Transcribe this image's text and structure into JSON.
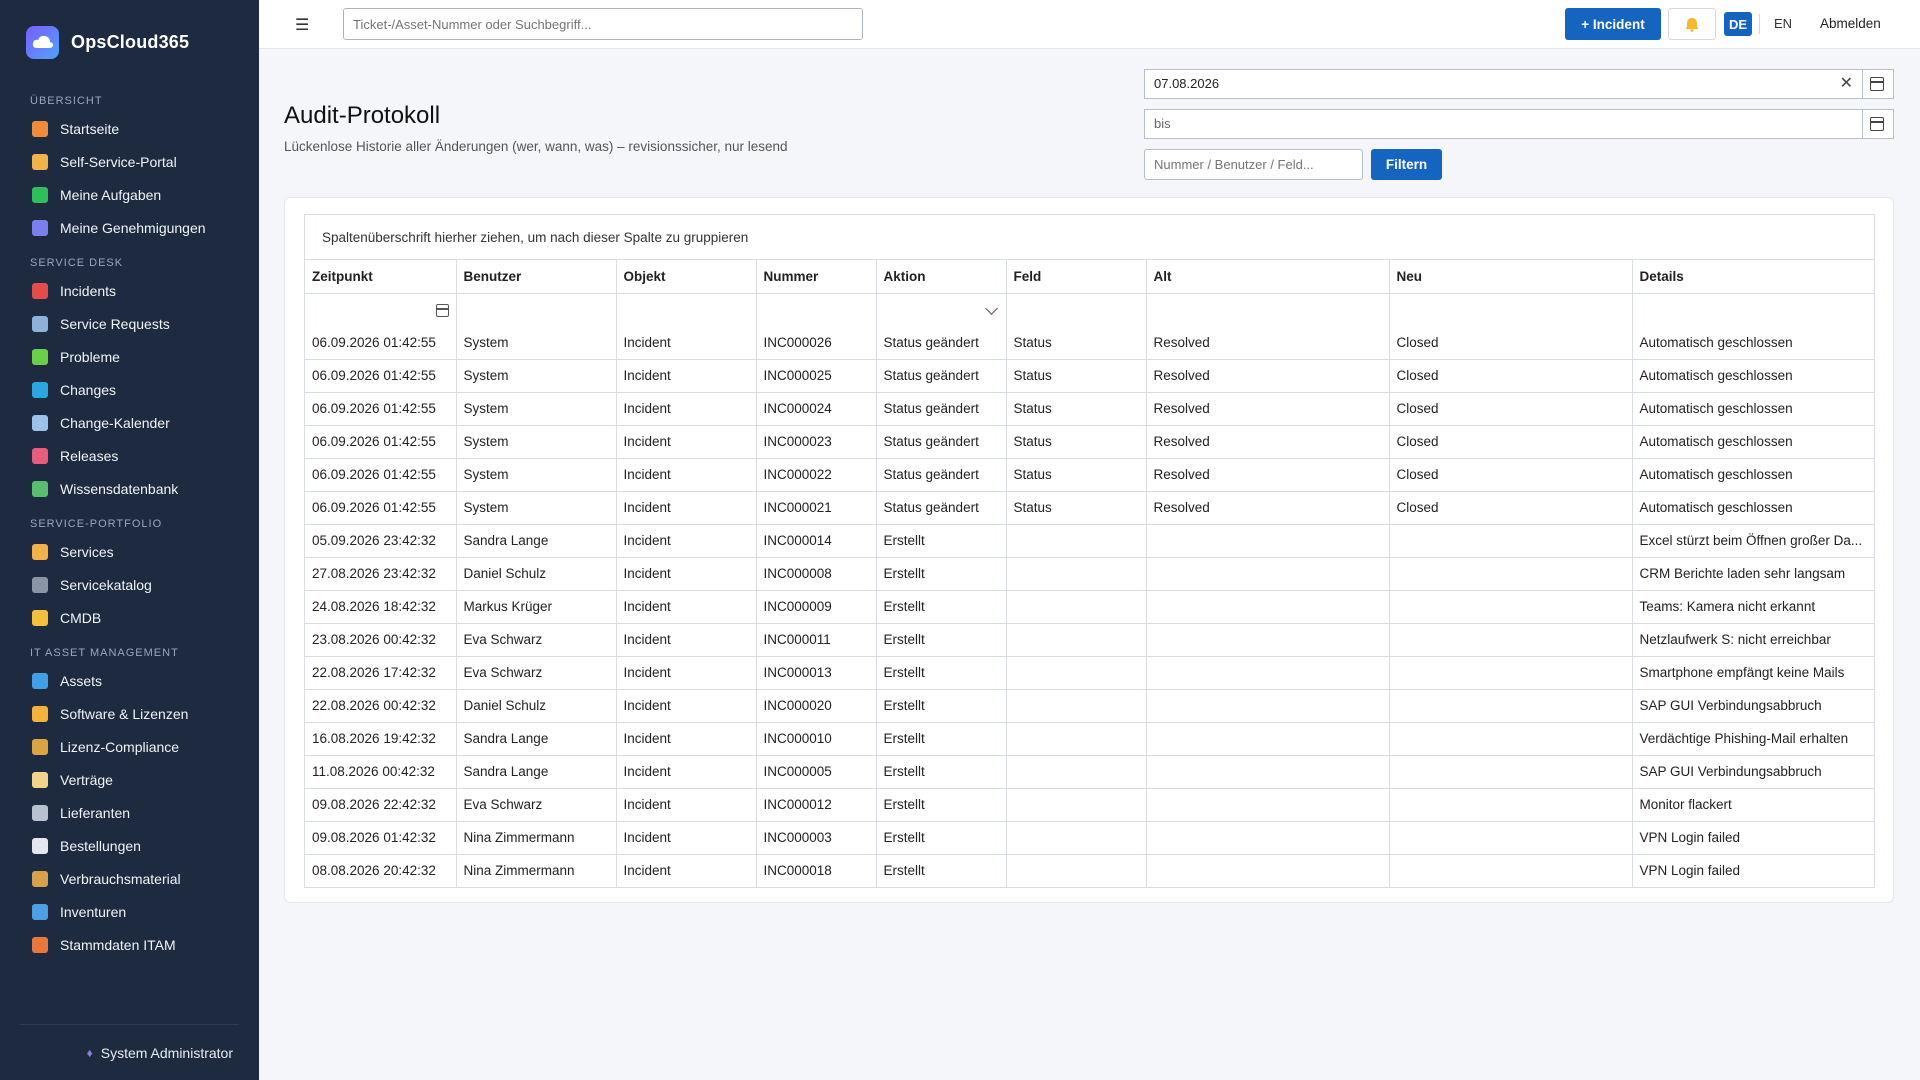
{
  "app": {
    "name": "OpsCloud365"
  },
  "topbar": {
    "search_placeholder": "Ticket-/Asset-Nummer oder Suchbegriff...",
    "incident_button": "+ Incident",
    "lang_de": "DE",
    "lang_en": "EN",
    "logout": "Abmelden"
  },
  "sidebar": {
    "sections": [
      {
        "title": "ÜBERSICHT",
        "items": [
          {
            "label": "Startseite",
            "icon": "home-icon",
            "color": "#f08a3c"
          },
          {
            "label": "Self-Service-Portal",
            "icon": "person-icon",
            "color": "#f2b24a"
          },
          {
            "label": "Meine Aufgaben",
            "icon": "checkbox-icon",
            "color": "#2fbf5a"
          },
          {
            "label": "Meine Genehmigungen",
            "icon": "checkmark-icon",
            "color": "#7a7ff0"
          }
        ]
      },
      {
        "title": "SERVICE DESK",
        "items": [
          {
            "label": "Incidents",
            "icon": "alarm-icon",
            "color": "#e44b4b"
          },
          {
            "label": "Service Requests",
            "icon": "inbox-icon",
            "color": "#8fb0d8"
          },
          {
            "label": "Probleme",
            "icon": "puzzle-icon",
            "color": "#6bcf4a"
          },
          {
            "label": "Changes",
            "icon": "cycle-icon",
            "color": "#2aa7e0"
          },
          {
            "label": "Change-Kalender",
            "icon": "calendar-icon",
            "color": "#9ec1ea"
          },
          {
            "label": "Releases",
            "icon": "rocket-icon",
            "color": "#e85c7a"
          },
          {
            "label": "Wissensdatenbank",
            "icon": "books-icon",
            "color": "#5bbd6e"
          }
        ]
      },
      {
        "title": "SERVICE-PORTFOLIO",
        "items": [
          {
            "label": "Services",
            "icon": "bell-service-icon",
            "color": "#f2b24a"
          },
          {
            "label": "Servicekatalog",
            "icon": "catalog-icon",
            "color": "#8a96a8"
          },
          {
            "label": "CMDB",
            "icon": "folder-icon",
            "color": "#f2c13c"
          }
        ]
      },
      {
        "title": "IT ASSET MANAGEMENT",
        "items": [
          {
            "label": "Assets",
            "icon": "monitor-icon",
            "color": "#3fa0e6"
          },
          {
            "label": "Software & Lizenzen",
            "icon": "disc-icon",
            "color": "#f2b23c"
          },
          {
            "label": "Lizenz-Compliance",
            "icon": "scale-icon",
            "color": "#d9a441"
          },
          {
            "label": "Verträge",
            "icon": "document-icon",
            "color": "#f0d48a"
          },
          {
            "label": "Lieferanten",
            "icon": "building-icon",
            "color": "#b7c1cf"
          },
          {
            "label": "Bestellungen",
            "icon": "receipt-icon",
            "color": "#e4e8ee"
          },
          {
            "label": "Verbrauchsmaterial",
            "icon": "package-icon",
            "color": "#d8a04a"
          },
          {
            "label": "Inventuren",
            "icon": "magnifier-icon",
            "color": "#4a9fe6"
          },
          {
            "label": "Stammdaten ITAM",
            "icon": "bricks-icon",
            "color": "#e8773e"
          }
        ]
      }
    ],
    "user": "System Administrator"
  },
  "page": {
    "title": "Audit-Protokoll",
    "subtitle": "Lückenlose Historie aller Änderungen (wer, wann, was) – revisionssicher, nur lesend",
    "date_from": "07.08.2026",
    "date_to_placeholder": "bis",
    "filter_placeholder": "Nummer / Benutzer / Feld...",
    "filter_button": "Filtern"
  },
  "grid": {
    "group_hint": "Spaltenüberschrift hierher ziehen, um nach dieser Spalte zu gruppieren",
    "columns": [
      "Zeitpunkt",
      "Benutzer",
      "Objekt",
      "Nummer",
      "Aktion",
      "Feld",
      "Alt",
      "Neu",
      "Details"
    ],
    "rows": [
      [
        "06.09.2026 01:42:55",
        "System",
        "Incident",
        "INC000026",
        "Status geändert",
        "Status",
        "Resolved",
        "Closed",
        "Automatisch geschlossen"
      ],
      [
        "06.09.2026 01:42:55",
        "System",
        "Incident",
        "INC000025",
        "Status geändert",
        "Status",
        "Resolved",
        "Closed",
        "Automatisch geschlossen"
      ],
      [
        "06.09.2026 01:42:55",
        "System",
        "Incident",
        "INC000024",
        "Status geändert",
        "Status",
        "Resolved",
        "Closed",
        "Automatisch geschlossen"
      ],
      [
        "06.09.2026 01:42:55",
        "System",
        "Incident",
        "INC000023",
        "Status geändert",
        "Status",
        "Resolved",
        "Closed",
        "Automatisch geschlossen"
      ],
      [
        "06.09.2026 01:42:55",
        "System",
        "Incident",
        "INC000022",
        "Status geändert",
        "Status",
        "Resolved",
        "Closed",
        "Automatisch geschlossen"
      ],
      [
        "06.09.2026 01:42:55",
        "System",
        "Incident",
        "INC000021",
        "Status geändert",
        "Status",
        "Resolved",
        "Closed",
        "Automatisch geschlossen"
      ],
      [
        "05.09.2026 23:42:32",
        "Sandra Lange",
        "Incident",
        "INC000014",
        "Erstellt",
        "",
        "",
        "",
        "Excel stürzt beim Öffnen großer Da..."
      ],
      [
        "27.08.2026 23:42:32",
        "Daniel Schulz",
        "Incident",
        "INC000008",
        "Erstellt",
        "",
        "",
        "",
        "CRM Berichte laden sehr langsam"
      ],
      [
        "24.08.2026 18:42:32",
        "Markus Krüger",
        "Incident",
        "INC000009",
        "Erstellt",
        "",
        "",
        "",
        "Teams: Kamera nicht erkannt"
      ],
      [
        "23.08.2026 00:42:32",
        "Eva Schwarz",
        "Incident",
        "INC000011",
        "Erstellt",
        "",
        "",
        "",
        "Netzlaufwerk S: nicht erreichbar"
      ],
      [
        "22.08.2026 17:42:32",
        "Eva Schwarz",
        "Incident",
        "INC000013",
        "Erstellt",
        "",
        "",
        "",
        "Smartphone empfängt keine Mails"
      ],
      [
        "22.08.2026 00:42:32",
        "Daniel Schulz",
        "Incident",
        "INC000020",
        "Erstellt",
        "",
        "",
        "",
        "SAP GUI Verbindungsabbruch"
      ],
      [
        "16.08.2026 19:42:32",
        "Sandra Lange",
        "Incident",
        "INC000010",
        "Erstellt",
        "",
        "",
        "",
        "Verdächtige Phishing-Mail erhalten"
      ],
      [
        "11.08.2026 00:42:32",
        "Sandra Lange",
        "Incident",
        "INC000005",
        "Erstellt",
        "",
        "",
        "",
        "SAP GUI Verbindungsabbruch"
      ],
      [
        "09.08.2026 22:42:32",
        "Eva Schwarz",
        "Incident",
        "INC000012",
        "Erstellt",
        "",
        "",
        "",
        "Monitor flackert"
      ],
      [
        "09.08.2026 01:42:32",
        "Nina Zimmermann",
        "Incident",
        "INC000003",
        "Erstellt",
        "",
        "",
        "",
        "VPN Login failed"
      ],
      [
        "08.08.2026 20:42:32",
        "Nina Zimmermann",
        "Incident",
        "INC000018",
        "Erstellt",
        "",
        "",
        "",
        "VPN Login failed"
      ]
    ]
  }
}
